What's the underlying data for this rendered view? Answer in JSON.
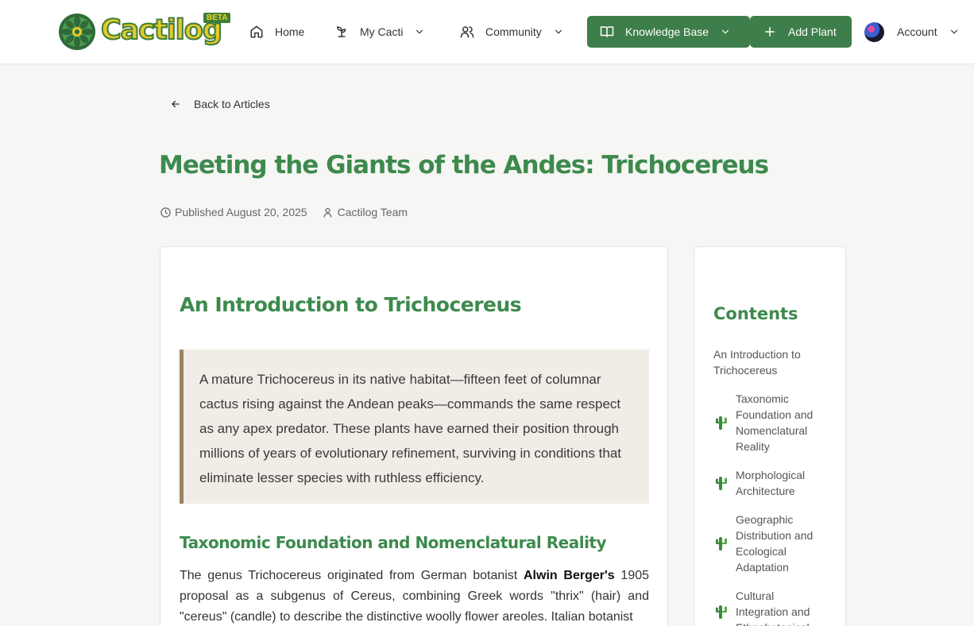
{
  "header": {
    "logo_text": "Cactilog",
    "beta_label": "BETA",
    "nav": {
      "home": "Home",
      "my_cacti": "My Cacti",
      "community": "Community",
      "knowledge_base": "Knowledge Base",
      "add_plant": "Add Plant",
      "account": "Account"
    }
  },
  "back_link": "Back to Articles",
  "article": {
    "title": "Meeting the Giants of the Andes: Trichocereus",
    "published": "Published August 20, 2025",
    "author": "Cactilog Team",
    "intro_heading": "An Introduction to Trichocereus",
    "quote": "A mature Trichocereus in its native habitat—fifteen feet of columnar cactus rising against the Andean peaks—commands the same respect as any apex predator. These plants have earned their position through millions of years of evolutionary refinement, surviving in conditions that eliminate lesser species with ruthless efficiency.",
    "section_heading": "Taxonomic Foundation and Nomenclatural Reality",
    "para_before": "The genus Trichocereus originated from German botanist ",
    "para_bold": "Alwin Berger's",
    "para_after": " 1905 proposal as a subgenus of Cereus, combining Greek words \"thrix\" (hair) and \"cereus\" (candle) to describe the distinctive woolly flower areoles. Italian botanist"
  },
  "toc": {
    "title": "Contents",
    "items": [
      "An Introduction to Trichocereus",
      "Taxonomic Foundation and Nomenclatural Reality",
      "Morphological Architecture",
      "Geographic Distribution and Ecological Adaptation",
      "Cultural Integration and Ethnobotanical"
    ]
  },
  "colors": {
    "brand_green": "#3d8a4d",
    "button_green": "#3e7e4a",
    "logo_yellow": "#e3c92a",
    "quote_border": "#9a8461"
  },
  "icons": [
    "home-icon",
    "sprout-icon",
    "users-icon",
    "book-icon",
    "plus-icon",
    "chevron-down-icon",
    "arrow-left-icon",
    "clock-icon",
    "user-icon",
    "cactus-icon"
  ]
}
